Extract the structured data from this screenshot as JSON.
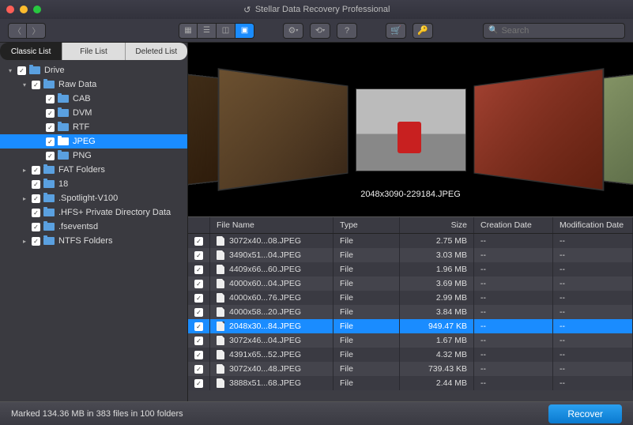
{
  "titlebar": {
    "title": "Stellar Data Recovery Professional"
  },
  "search": {
    "placeholder": "Search"
  },
  "list_tabs": [
    "Classic List",
    "File List",
    "Deleted List"
  ],
  "tree": [
    {
      "indent": 0,
      "caret": "down",
      "check": true,
      "label": "Drive"
    },
    {
      "indent": 1,
      "caret": "down",
      "check": true,
      "label": "Raw Data"
    },
    {
      "indent": 2,
      "caret": "",
      "check": true,
      "label": "CAB"
    },
    {
      "indent": 2,
      "caret": "",
      "check": true,
      "label": "DVM"
    },
    {
      "indent": 2,
      "caret": "",
      "check": true,
      "label": "RTF"
    },
    {
      "indent": 2,
      "caret": "",
      "check": true,
      "label": "JPEG",
      "selected": true
    },
    {
      "indent": 2,
      "caret": "",
      "check": true,
      "label": "PNG"
    },
    {
      "indent": 1,
      "caret": "right",
      "check": true,
      "label": "FAT Folders"
    },
    {
      "indent": 1,
      "caret": "",
      "check": true,
      "label": "18"
    },
    {
      "indent": 1,
      "caret": "right",
      "check": true,
      "label": ".Spotlight-V100"
    },
    {
      "indent": 1,
      "caret": "",
      "check": true,
      "label": ".HFS+ Private Directory Data"
    },
    {
      "indent": 1,
      "caret": "",
      "check": true,
      "label": ".fseventsd"
    },
    {
      "indent": 1,
      "caret": "right",
      "check": true,
      "label": "NTFS Folders"
    }
  ],
  "coverflow": {
    "label": "2048x3090-229184.JPEG"
  },
  "columns": {
    "name": "File Name",
    "type": "Type",
    "size": "Size",
    "cdate": "Creation Date",
    "mdate": "Modification Date"
  },
  "rows": [
    {
      "name": "3072x40...08.JPEG",
      "type": "File",
      "size": "2.75 MB",
      "cdate": "--",
      "mdate": "--"
    },
    {
      "name": "3490x51...04.JPEG",
      "type": "File",
      "size": "3.03 MB",
      "cdate": "--",
      "mdate": "--"
    },
    {
      "name": "4409x66...60.JPEG",
      "type": "File",
      "size": "1.96 MB",
      "cdate": "--",
      "mdate": "--"
    },
    {
      "name": "4000x60...04.JPEG",
      "type": "File",
      "size": "3.69 MB",
      "cdate": "--",
      "mdate": "--"
    },
    {
      "name": "4000x60...76.JPEG",
      "type": "File",
      "size": "2.99 MB",
      "cdate": "--",
      "mdate": "--"
    },
    {
      "name": "4000x58...20.JPEG",
      "type": "File",
      "size": "3.84 MB",
      "cdate": "--",
      "mdate": "--"
    },
    {
      "name": "2048x30...84.JPEG",
      "type": "File",
      "size": "949.47 KB",
      "cdate": "--",
      "mdate": "--",
      "selected": true
    },
    {
      "name": "3072x46...04.JPEG",
      "type": "File",
      "size": "1.67 MB",
      "cdate": "--",
      "mdate": "--"
    },
    {
      "name": "4391x65...52.JPEG",
      "type": "File",
      "size": "4.32 MB",
      "cdate": "--",
      "mdate": "--"
    },
    {
      "name": "3072x40...48.JPEG",
      "type": "File",
      "size": "739.43 KB",
      "cdate": "--",
      "mdate": "--"
    },
    {
      "name": "3888x51...68.JPEG",
      "type": "File",
      "size": "2.44 MB",
      "cdate": "--",
      "mdate": "--"
    }
  ],
  "footer": {
    "status": "Marked 134.36 MB in 383 files in 100 folders",
    "recover": "Recover"
  }
}
